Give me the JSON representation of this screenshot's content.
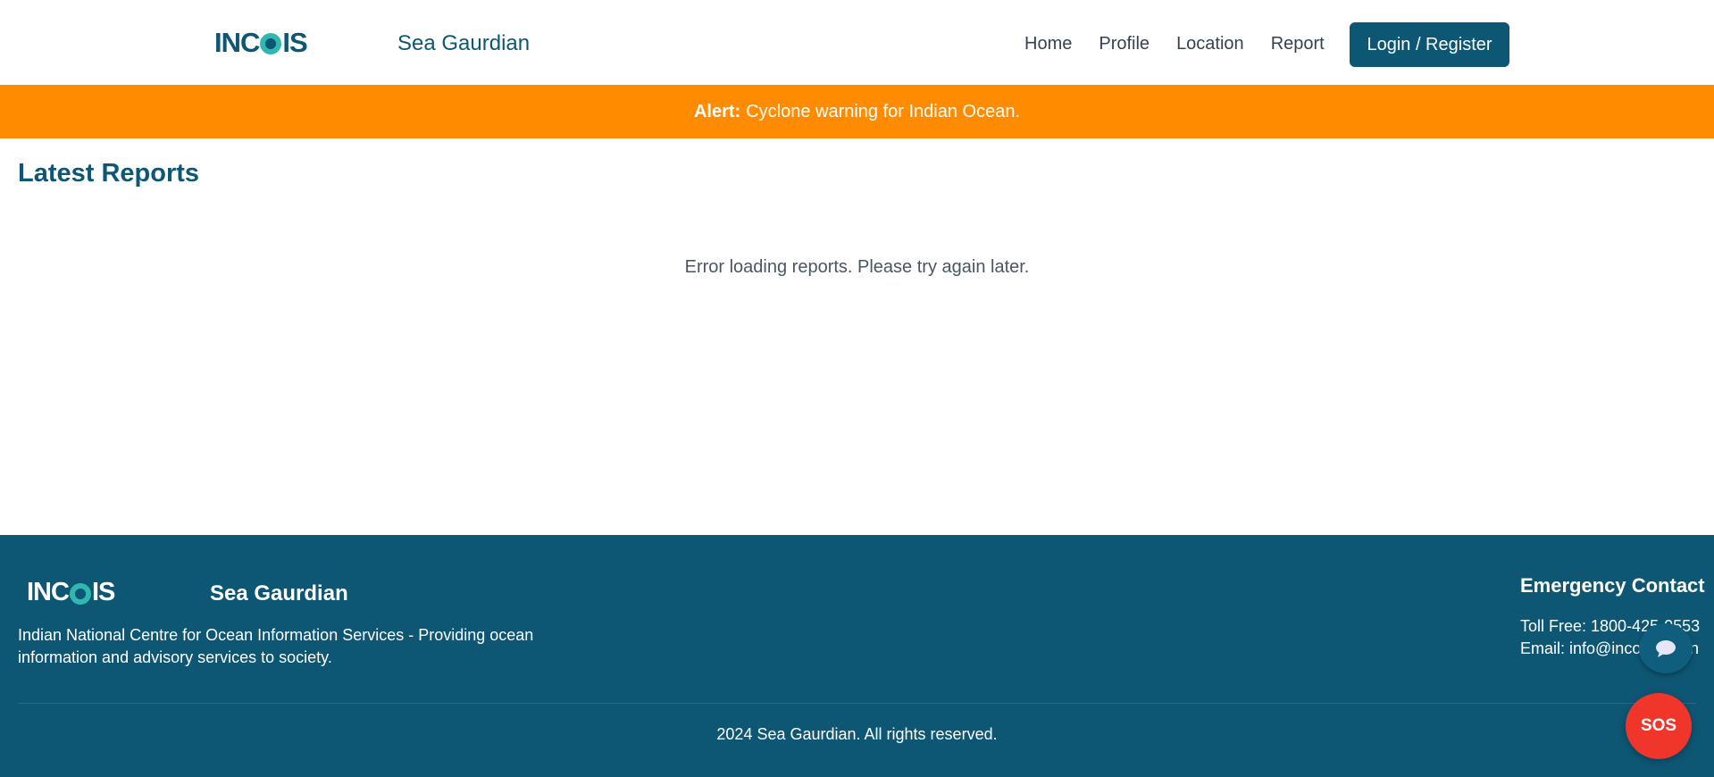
{
  "header": {
    "logo_text_left": "INC",
    "logo_text_right": "IS",
    "brand": "Sea Gaurdian",
    "nav": [
      "Home",
      "Profile",
      "Location",
      "Report"
    ],
    "login_label": "Login / Register"
  },
  "alert": {
    "label": "Alert:",
    "message": "Cyclone warning for Indian Ocean."
  },
  "main": {
    "title": "Latest Reports",
    "error": "Error loading reports. Please try again later."
  },
  "footer": {
    "logo_text_left": "INC",
    "logo_text_right": "IS",
    "brand": "Sea Gaurdian",
    "description": "Indian National Centre for Ocean Information Services - Providing ocean information and advisory services to society.",
    "emergency_title": "Emergency Contact",
    "toll_free": "Toll Free: 1800-425-0553",
    "email": "Email: info@incois.gov.in",
    "copyright": "2024 Sea Gaurdian. All rights reserved."
  },
  "floating": {
    "chat_icon": "chat-bubble-icon",
    "sos_label": "SOS"
  },
  "colors": {
    "primary": "#0d5775",
    "alert": "#ff8c00",
    "sos": "#f0352a",
    "logo_accent": "#2fb7b0"
  }
}
